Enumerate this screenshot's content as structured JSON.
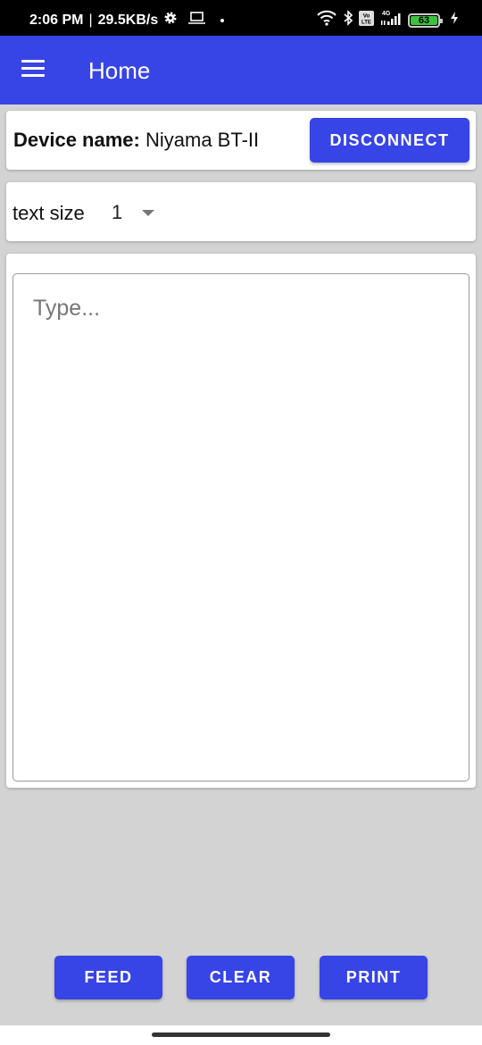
{
  "status_bar": {
    "time": "2:06 PM",
    "separator": "|",
    "network_speed": "29.5KB/s",
    "icons_left": [
      "gear-icon",
      "laptop-icon",
      "dot-icon"
    ],
    "icons_right": [
      "wifi-icon",
      "bluetooth-icon",
      "volte-icon",
      "signal-4g-icon",
      "battery-icon",
      "charging-icon"
    ],
    "network_type": "4G",
    "volte_label": "Vo LTE",
    "battery_level": "63"
  },
  "appbar": {
    "menu_icon": "hamburger-menu-icon",
    "title": "Home"
  },
  "device": {
    "label": "Device name:",
    "name": "Niyama BT-II",
    "disconnect_label": "DISCONNECT"
  },
  "text_size": {
    "label": "text size",
    "selected": "1"
  },
  "editor": {
    "placeholder": "Type...",
    "value": ""
  },
  "actions": {
    "feed_label": "FEED",
    "clear_label": "CLEAR",
    "print_label": "PRINT"
  },
  "colors": {
    "primary": "#3744e6",
    "background": "#d3d3d3",
    "card": "#ffffff"
  }
}
